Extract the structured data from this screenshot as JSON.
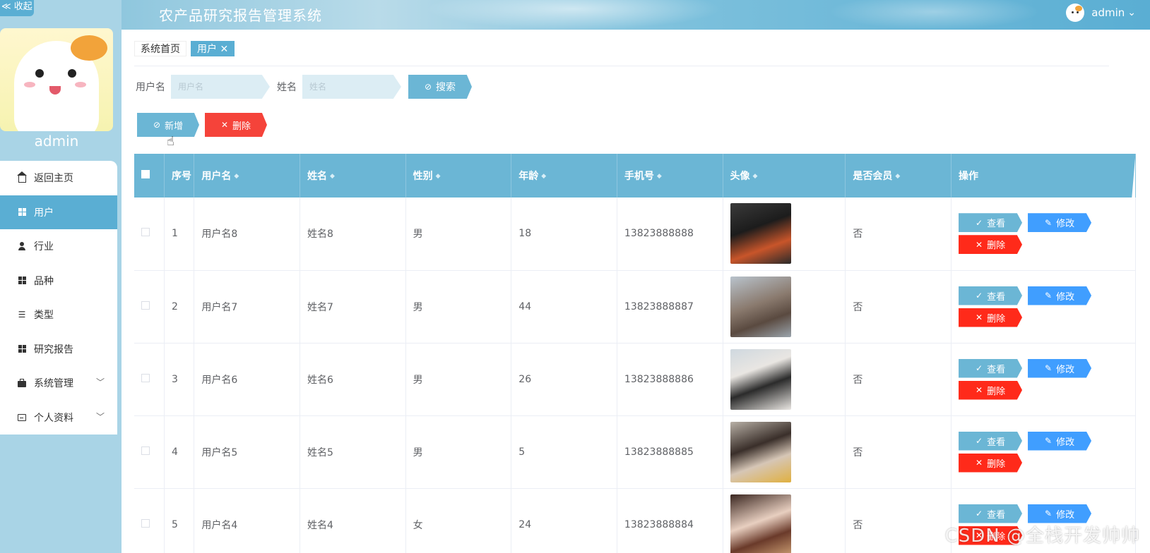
{
  "app": {
    "title": "农产品研究报告管理系统",
    "collapse_label": "≪ 收起",
    "user_name": "admin",
    "user_caret": "⌄"
  },
  "sidebar": {
    "profile_name": "admin",
    "items": [
      {
        "label": "返回主页",
        "icon": "home-icon"
      },
      {
        "label": "用户",
        "icon": "grid-icon",
        "active": true
      },
      {
        "label": "行业",
        "icon": "person-icon"
      },
      {
        "label": "品种",
        "icon": "grid-icon"
      },
      {
        "label": "类型",
        "icon": "sliders-icon"
      },
      {
        "label": "研究报告",
        "icon": "grid-icon"
      },
      {
        "label": "系统管理",
        "icon": "briefcase-icon",
        "has_children": true
      },
      {
        "label": "个人资料",
        "icon": "card-icon",
        "has_children": true
      }
    ]
  },
  "breadcrumb": {
    "home": "系统首页",
    "current": "用户 ✕"
  },
  "search": {
    "username_label": "用户名",
    "username_placeholder": "用户名",
    "name_label": "姓名",
    "name_placeholder": "姓名",
    "search_button": "搜索"
  },
  "actions": {
    "add_button": "新增",
    "delete_button": "删除"
  },
  "table": {
    "columns": [
      "序号",
      "用户名",
      "姓名",
      "性别",
      "年龄",
      "手机号",
      "头像",
      "是否会员",
      "操作"
    ],
    "view_label": "查看",
    "edit_label": "修改",
    "delete_label": "删除",
    "rows": [
      {
        "index": "1",
        "username": "用户名8",
        "name": "姓名8",
        "gender": "男",
        "age": "18",
        "phone": "13823888888",
        "member": "否"
      },
      {
        "index": "2",
        "username": "用户名7",
        "name": "姓名7",
        "gender": "男",
        "age": "44",
        "phone": "13823888887",
        "member": "否"
      },
      {
        "index": "3",
        "username": "用户名6",
        "name": "姓名6",
        "gender": "男",
        "age": "26",
        "phone": "13823888886",
        "member": "否"
      },
      {
        "index": "4",
        "username": "用户名5",
        "name": "姓名5",
        "gender": "男",
        "age": "5",
        "phone": "13823888885",
        "member": "否"
      },
      {
        "index": "5",
        "username": "用户名4",
        "name": "姓名4",
        "gender": "女",
        "age": "24",
        "phone": "13823888884",
        "member": "否"
      }
    ]
  },
  "watermark": "CSDN @全栈开发帅帅",
  "colors": {
    "primary": "#6bb6d5",
    "accent": "#5aaed3",
    "edit": "#409eff",
    "danger": "#ff2a1a"
  }
}
